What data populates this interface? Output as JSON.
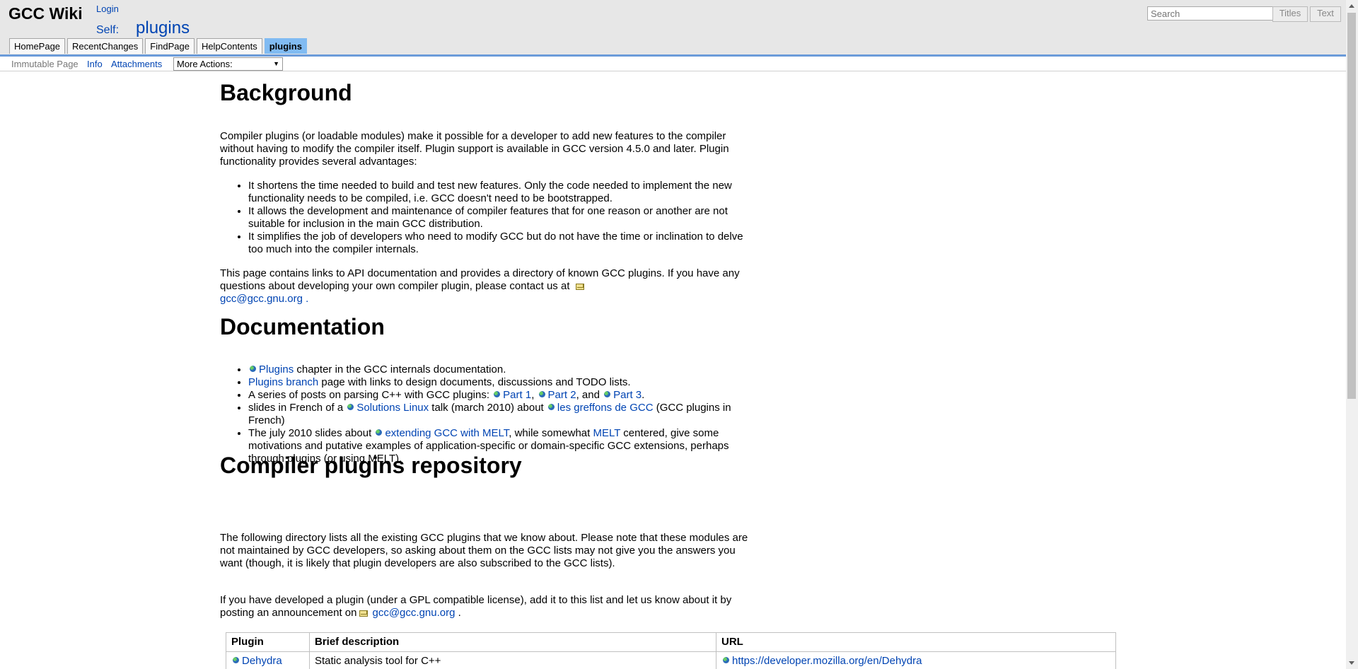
{
  "header": {
    "logo": "GCC Wiki",
    "login": "Login",
    "self_label": "Self:",
    "page_name": "plugins",
    "search_placeholder": "Search",
    "titles_button": "Titles",
    "text_button": "Text",
    "tabs": [
      "HomePage",
      "RecentChanges",
      "FindPage",
      "HelpContents",
      "plugins"
    ]
  },
  "actions": {
    "immutable": "Immutable Page",
    "info": "Info",
    "attachments": "Attachments",
    "more_actions": "More Actions:"
  },
  "background": {
    "heading": "Background",
    "intro": "Compiler plugins (or loadable modules) make it possible for a developer to add new features to the compiler without having to modify the compiler itself. Plugin support is available in GCC version 4.5.0 and later. Plugin functionality provides several advantages:",
    "bullets": [
      "It shortens the time needed to build and test new features. Only the code needed to implement the new functionality needs to be compiled, i.e. GCC doesn't need to be bootstrapped.",
      "It allows the development and maintenance of compiler features that for one reason or another are not suitable for inclusion in the main GCC distribution.",
      "It simplifies the job of developers who need to modify GCC but do not have the time or inclination to delve too much into the compiler internals."
    ],
    "contact_text": "This page contains links to API documentation and provides a directory of known GCC plugins. If you have any questions about developing your own compiler plugin, please contact us at",
    "contact_email": "gcc@gcc.gnu.org",
    "contact_end": "."
  },
  "documentation": {
    "heading": "Documentation",
    "item1_link": "Plugins",
    "item1_text": " chapter in the GCC internals documentation.",
    "item2_link": "Plugins branch",
    "item2_text": " page with links to design documents, discussions and TODO lists.",
    "item3_text": "A series of posts on parsing C++ with GCC plugins: ",
    "item3_part1": "Part 1",
    "item3_part2": "Part 2",
    "item3_and": " and ",
    "item3_part3": "Part 3",
    "item4_text1": "slides in French of a ",
    "item4_link1": "Solutions Linux",
    "item4_text2": " talk (march 2010) about ",
    "item4_link2": "les greffons de GCC",
    "item4_text3": " (GCC plugins in French)",
    "item5_text1": "The july 2010 slides about ",
    "item5_link1": "extending GCC with MELT",
    "item5_text2": ", while somewhat ",
    "item5_link2": "MELT",
    "item5_text3": " centered, give some motivations and putative examples of application-specific or domain-specific GCC extensions, perhaps through plugins (or using MELT)."
  },
  "repository": {
    "heading": "Compiler plugins repository",
    "para1": "The following directory lists all the existing GCC plugins that we know about. Please note that these modules are not maintained by GCC developers, so asking about them on the GCC lists may not give you the answers you want (though, it is likely that plugin developers are also subscribed to the GCC lists).",
    "para2": "If you have developed a plugin (under a GPL compatible license), add it to this list and let us know about it by posting an announcement on",
    "para2_email": "gcc@gcc.gnu.org",
    "para2_end": ".",
    "table": {
      "headers": [
        "Plugin",
        "Brief description",
        "URL"
      ],
      "rows": [
        {
          "plugin": "Dehydra",
          "description": "Static analysis tool for C++",
          "url": "https://developer.mozilla.org/en/Dehydra"
        }
      ]
    }
  }
}
